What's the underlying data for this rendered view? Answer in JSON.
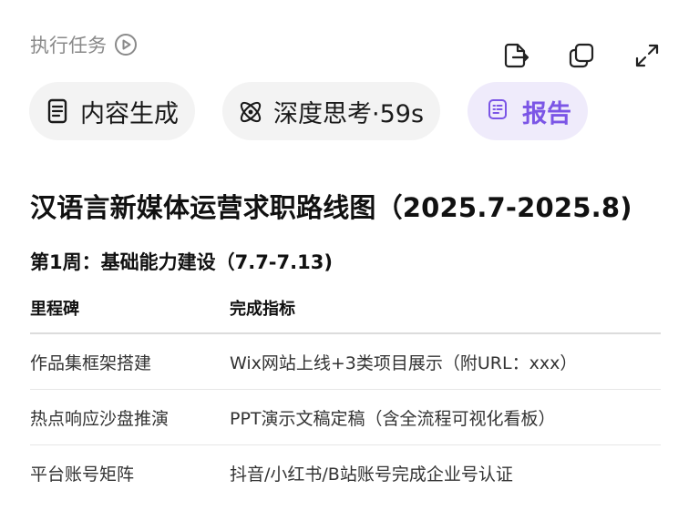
{
  "task": {
    "title": "执行任务",
    "play_icon": "play-circle-icon"
  },
  "toolbar": {
    "icons": [
      "export-icon",
      "copy-icon",
      "expand-icon"
    ]
  },
  "chips": [
    {
      "label": "内容生成",
      "icon": "document-icon",
      "active": false
    },
    {
      "label": "深度思考·59s",
      "icon": "atom-icon",
      "active": false
    },
    {
      "label": "报告",
      "icon": "report-icon",
      "active": true
    }
  ],
  "colors": {
    "accent": "#7b55e6",
    "accent_bg": "#efebfb",
    "chip_bg": "#f3f3f3",
    "muted_text": "#8a8a8a"
  },
  "document": {
    "title": "汉语言新媒体运营求职路线图（2025.7-2025.8)",
    "section": "第1周：基础能力建设（7.7-7.13)",
    "table": {
      "headers": [
        "里程碑",
        "完成指标"
      ],
      "rows": [
        [
          "作品集框架搭建",
          "Wix网站上线+3类项目展示（附URL：xxx）"
        ],
        [
          "热点响应沙盘推演",
          "PPT演示文稿定稿（含全流程可视化看板）"
        ],
        [
          "平台账号矩阵",
          "抖音/小红书/B站账号完成企业号认证"
        ]
      ]
    }
  }
}
